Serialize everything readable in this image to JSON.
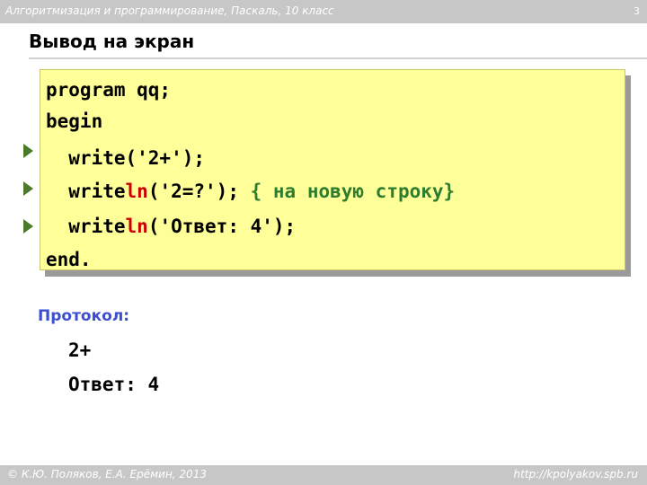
{
  "header": {
    "course": "Алгоритмизация и программирование, Паскаль, 10 класс",
    "page_number": "3"
  },
  "slide": {
    "title": "Вывод на экран"
  },
  "code": {
    "line1": "program qq;",
    "line2": "begin",
    "line3": "  write('2+');",
    "line4_a": "  write",
    "line4_ln": "ln",
    "line4_b": "('2=?'); ",
    "line4_comment": "{ на новую строку}",
    "line5_a": "  write",
    "line5_ln": "ln",
    "line5_b": "('Ответ: 4');",
    "line6": "end."
  },
  "protocol": {
    "label": "Протокол:",
    "output": [
      "2+",
      "Ответ: 4"
    ]
  },
  "footer": {
    "copyright": "© К.Ю. Поляков, Е.А. Ерёмин, 2013",
    "site": "http://kpolyakov.spb.ru"
  },
  "colors": {
    "code_background": "#ffff99",
    "keyword_ln": "#cc0000",
    "comment": "#2e7d2e",
    "protocol_label": "#3b4fcf",
    "bullet": "#4a7a2a"
  }
}
